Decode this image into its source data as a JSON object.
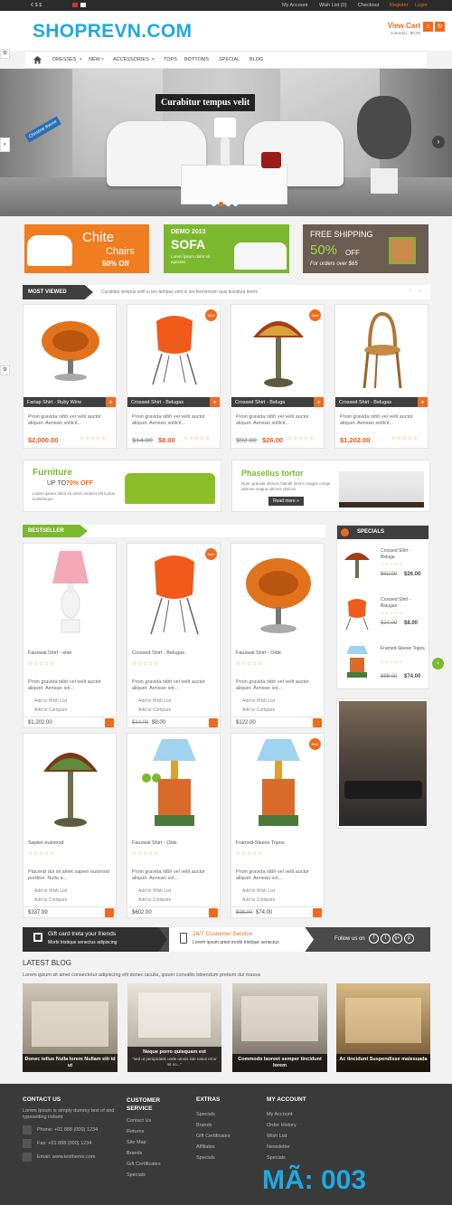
{
  "topbar": {
    "currencies": "€  $  $",
    "account": "My Account",
    "wishlist": "Wish List (0)",
    "checkout": "Checkout",
    "register": "Register",
    "login": "Login"
  },
  "header": {
    "logo": "SHOPREVN.COM",
    "cart_label": "View Cart",
    "cart_items": "0 item(s) - $0.00"
  },
  "nav": {
    "items": [
      "DRESSES",
      "NEW",
      "ACCESSORIES",
      "TOPS",
      "BOTTOMS",
      "SPECIAL",
      "BLOG"
    ]
  },
  "slider": {
    "caption": "Curabitur tempus velit",
    "badge": "Christine theme"
  },
  "promos": {
    "chite_title": "Chite",
    "chite_sub": "Chairs",
    "chite_off": "50% Off",
    "demo_label": "DEMO 2013",
    "demo_title": "SOFA",
    "demo_text": "Lorem ipsum dolor sit egestas.",
    "ship_title": "FREE SHIPPING",
    "ship_pct": "50%",
    "ship_off": "OFF",
    "ship_sub": "For orders over $65"
  },
  "most_viewed": {
    "title": "MOST VIEWED",
    "tagline": "Curabitur tempus velit in leo tempus velit in leo fermentum quis tincidunt lorem",
    "items": [
      {
        "name": "Farlap Shirt - Ruby Wine",
        "desc": "Proin gravida nibh vel velit auctor aliquet. Aenean sollicit...",
        "price": "$2,000.00",
        "old": "",
        "sale": false
      },
      {
        "name": "Crossed Shirt - Belugas",
        "desc": "Proin gravida nibh vel velit auctor aliquet. Aenean sollicit...",
        "price": "$8.00",
        "old": "$14.00",
        "sale": true
      },
      {
        "name": "Crossed Shirt - Beluga",
        "desc": "Proin gravida nibh vel velit auctor aliquet. Aenean sollicit...",
        "price": "$26.00",
        "old": "$92.00",
        "sale": true
      },
      {
        "name": "Crossed Shirt - Belugas",
        "desc": "Proin gravida nibh vel velit auctor aliquet. Aenean sollicit...",
        "price": "$1,202.00",
        "old": "",
        "sale": false
      }
    ]
  },
  "mid_banners": {
    "furniture_title": "Furniture",
    "furniture_sub": "UP TO",
    "furniture_pct": "70% OFF",
    "furniture_text": "Lorem ipsum dolor sit amet consect elit luctus scelerisque.",
    "phas_title": "Phasellus tortor",
    "phas_text": "Nunc gravida ultrices blandit lorem congue conge ultrices magna ultrices ultrices.",
    "read_more": "Read more »"
  },
  "bestseller": {
    "title": "BESTSELLER",
    "wish": "Add to Wish List",
    "compare": "Add to Compare",
    "items": [
      {
        "name": "Fauxwal Shirt - else",
        "desc": "Proin gravida nibh vel velit auctor aliquet. Aenean sol...",
        "price": "$1,202.00",
        "old": "",
        "sale": false
      },
      {
        "name": "Crossed Shirt - Belugas",
        "desc": "Proin gravida nibh vel velit auctor aliquet. Aenean sol...",
        "price": "$8.00",
        "old": "$14.00",
        "sale": true
      },
      {
        "name": "Fauxwal Shirt - Olde",
        "desc": "Proin gravida nibh vel velit auctor aliquet. Aenean sol...",
        "price": "$122.00",
        "old": "",
        "sale": false
      },
      {
        "name": "Sapien euismod",
        "desc": "Placerat dui sit amet sapien euismod porttitor. Nulla a...",
        "price": "$337.99",
        "old": "",
        "sale": false
      },
      {
        "name": "Fauxwal Shirt - Olds",
        "desc": "Proin gravida nibh vel velit auctor aliquet. Aenean sol...",
        "price": "$602.00",
        "old": "",
        "sale": false
      },
      {
        "name": "Framed-Sleeve Topos",
        "desc": "Proin gravida nibh vel velit auctor aliquet. Aenean sol...",
        "price": "$74.00",
        "old": "$98.00",
        "sale": true
      }
    ]
  },
  "specials": {
    "title": "SPECIALS",
    "items": [
      {
        "name": "Crossed Shirt - Beluga",
        "price": "$26.00",
        "old": "$92.00"
      },
      {
        "name": "Crossed Shirt - Belugas",
        "price": "$8.00",
        "old": "$14.00"
      },
      {
        "name": "Framed-Sleeve Topos",
        "price": "$74.00",
        "old": "$98.00"
      }
    ]
  },
  "strip": {
    "gift_title": "Gift card treta your friends",
    "gift_sub": "Morbi tristique senectus adipiscing",
    "cs_title": "24/7 Customer Service",
    "cs_sub": "Lorem ipsum amet morbi tristique senectus",
    "follow": "Follow us on"
  },
  "blog": {
    "title": "LATEST BLOG",
    "intro": "Lorem ipsum sit amet consectetur adipiscing elit donec iaculis, ipsum convallis bibendum pretium dui massa",
    "posts": [
      {
        "caption": "Donec tellus Nulla lorem Nullam elit id ut"
      },
      {
        "caption": "Neque porro quisquam est",
        "sub": "\"sed ut perspiciatis unde omnis iste natus error sit vo...\""
      },
      {
        "caption": "Commodo laoreet semper tincidunt lorem"
      },
      {
        "caption": "Ac tincidunt Suspendisse malesuada"
      }
    ]
  },
  "footer": {
    "contact": {
      "title": "CONTACT US",
      "text": "Lorem Ipsum is simply dummy text of and typesetting industr",
      "phone": "Phone: +01 888 (000) 1234",
      "fax": "Fax: +01 888 (000) 1234",
      "email": "Email: www.leotheme.com"
    },
    "service": {
      "title": "CUSTOMER SERVICE",
      "items": [
        "Contact Us",
        "Returns",
        "Site Map",
        "Brands",
        "Gift Certificates",
        "Specials"
      ]
    },
    "extras": {
      "title": "EXTRAS",
      "items": [
        "Specials",
        "Brands",
        "Gift Certificates",
        "Affiliates",
        "Specials"
      ]
    },
    "account": {
      "title": "MY ACCOUNT",
      "items": [
        "My Account",
        "Order History",
        "Wish List",
        "Newsletter",
        "Specials"
      ]
    },
    "watermark": "MÃ: 003"
  },
  "colors": {
    "accent": "#1eaae0",
    "orange": "#f06a1c",
    "green": "#7cb82f",
    "dark": "#3f3f3f"
  }
}
